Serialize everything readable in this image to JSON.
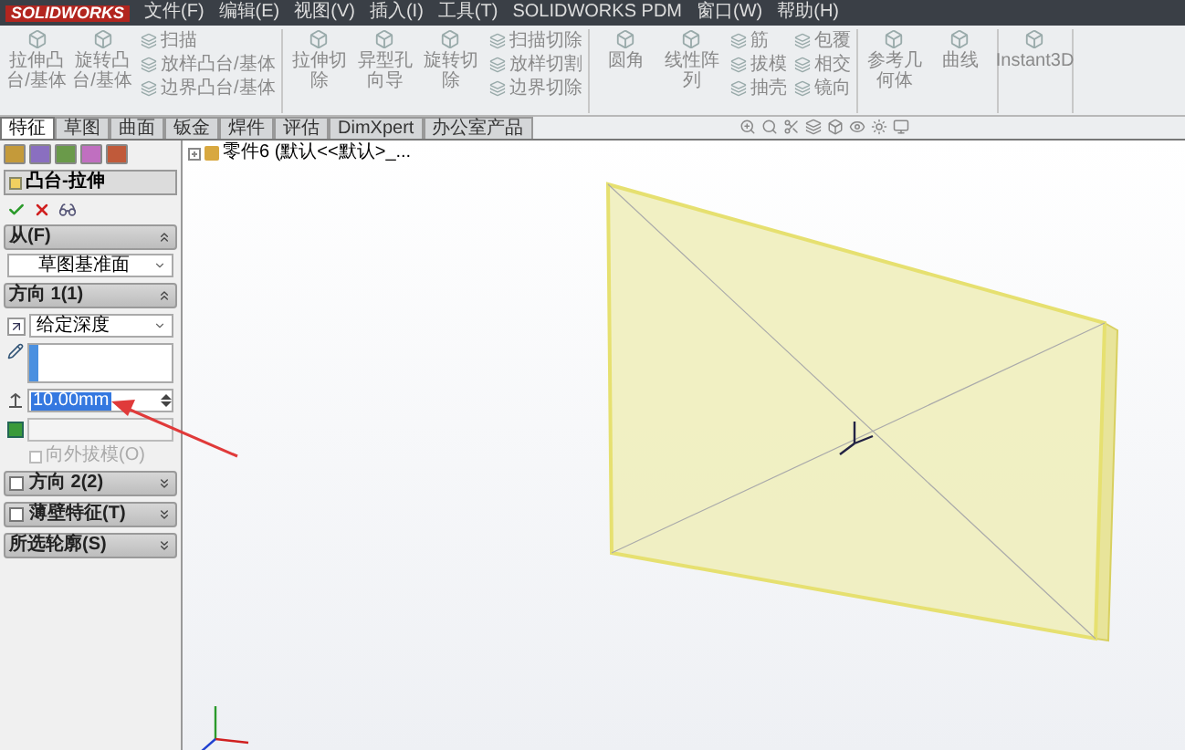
{
  "app": {
    "logo": "SOLIDWORKS"
  },
  "menu": [
    "文件(F)",
    "编辑(E)",
    "视图(V)",
    "插入(I)",
    "工具(T)",
    "SOLIDWORKS PDM",
    "窗口(W)",
    "帮助(H)"
  ],
  "ribbon": [
    {
      "large": [
        "拉伸凸台/基体",
        "旋转凸台/基体"
      ],
      "small": [
        [
          "扫描",
          "放样凸台/基体",
          "边界凸台/基体"
        ]
      ]
    },
    {
      "large": [
        "拉伸切除",
        "异型孔向导",
        "旋转切除"
      ],
      "small": [
        [
          "扫描切除",
          "放样切割",
          "边界切除"
        ]
      ]
    },
    {
      "large": [
        "圆角",
        "线性阵列"
      ],
      "small": [
        [
          "筋",
          "拔模",
          "抽壳"
        ],
        [
          "包覆",
          "相交",
          "镜向"
        ]
      ]
    },
    {
      "large": [
        "参考几何体",
        "曲线"
      ]
    },
    {
      "large": [
        "Instant3D"
      ]
    }
  ],
  "tabs": [
    {
      "label": "特征",
      "selected": true
    },
    {
      "label": "草图",
      "selected": false
    },
    {
      "label": "曲面",
      "selected": false
    },
    {
      "label": "钣金",
      "selected": false
    },
    {
      "label": "焊件",
      "selected": false
    },
    {
      "label": "评估",
      "selected": false
    },
    {
      "label": "DimXpert",
      "selected": false
    },
    {
      "label": "办公室产品",
      "selected": false
    }
  ],
  "panel": {
    "feature_title": "凸台-拉伸",
    "from": {
      "title": "从(F)",
      "value": "草图基准面",
      "expanded": true
    },
    "direction1": {
      "title": "方向 1(1)",
      "expanded": true,
      "end_condition": "给定深度",
      "depth": {
        "value": "10.00mm",
        "selected": true
      },
      "draft_outward": {
        "label": "向外拔模(O)",
        "checked": false,
        "disabled": true
      }
    },
    "sections": [
      {
        "kind": "checkbox",
        "title": "方向 2(2)",
        "checked": false,
        "expanded": false
      },
      {
        "kind": "checkbox",
        "title": "薄壁特征(T)",
        "checked": false,
        "expanded": false
      },
      {
        "kind": "plain",
        "title": "所选轮廓(S)",
        "expanded": false
      }
    ]
  },
  "tree": {
    "root": "零件6 (默认<<默认>_..."
  }
}
